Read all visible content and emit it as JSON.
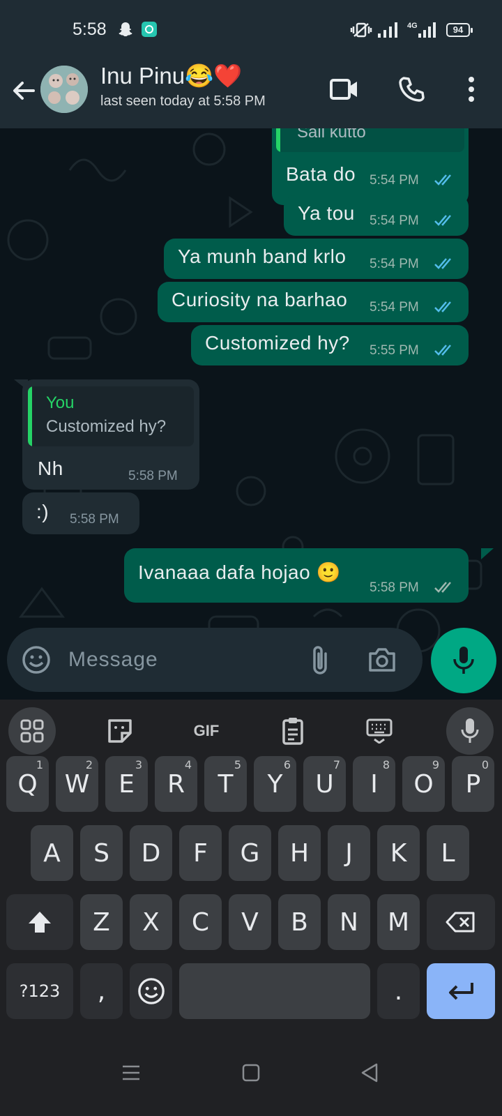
{
  "status_bar": {
    "time": "5:58",
    "network": "4G",
    "battery": "94"
  },
  "header": {
    "contact_name": "Inu Pinu😂❤️",
    "last_seen": "last seen today at 5:58 PM"
  },
  "messages": [
    {
      "text": "Bata do",
      "time": "5:54 PM",
      "direction": "out",
      "status": "read"
    },
    {
      "text": "Ya tou",
      "time": "5:54 PM",
      "direction": "out",
      "status": "read"
    },
    {
      "text": "Ya munh band krlo",
      "time": "5:54 PM",
      "direction": "out",
      "status": "read"
    },
    {
      "text": "Curiosity na barhao",
      "time": "5:54 PM",
      "direction": "out",
      "status": "read"
    },
    {
      "text": "Customized hy?",
      "time": "5:55 PM",
      "direction": "out",
      "status": "read"
    },
    {
      "text": "Nh",
      "time": "5:58 PM",
      "direction": "in",
      "quote_author": "You",
      "quote_text": "Customized hy?"
    },
    {
      "text": ":)",
      "time": "5:58 PM",
      "direction": "in"
    },
    {
      "text": "Ivanaaa dafa hojao 🙂",
      "time": "5:58 PM",
      "direction": "out",
      "status": "delivered"
    }
  ],
  "top_partial_quote": "Sali kutto",
  "composer": {
    "placeholder": "Message"
  },
  "keyboard": {
    "toolbar": {
      "gif_label": "GIF"
    },
    "row1": [
      "Q",
      "W",
      "E",
      "R",
      "T",
      "Y",
      "U",
      "I",
      "O",
      "P"
    ],
    "row1_hints": [
      "1",
      "2",
      "3",
      "4",
      "5",
      "6",
      "7",
      "8",
      "9",
      "0"
    ],
    "row2": [
      "A",
      "S",
      "D",
      "F",
      "G",
      "H",
      "J",
      "K",
      "L"
    ],
    "row3": [
      "Z",
      "X",
      "C",
      "V",
      "B",
      "N",
      "M"
    ],
    "symbols_label": "?123",
    "comma": ",",
    "period": "."
  },
  "colors": {
    "outgoing_bubble": "#005c4b",
    "incoming_bubble": "#202c33",
    "accent_green": "#25d366",
    "read_ticks": "#53bdeb",
    "enter_key": "#8ab4f8"
  },
  "icons": [
    "back-arrow-icon",
    "video-call-icon",
    "phone-icon",
    "more-vert-icon",
    "emoji-icon",
    "attach-icon",
    "camera-icon",
    "mic-icon",
    "apps-grid-icon",
    "sticker-icon",
    "clipboard-icon",
    "keyboard-icon",
    "shift-icon",
    "backspace-icon",
    "enter-icon"
  ]
}
